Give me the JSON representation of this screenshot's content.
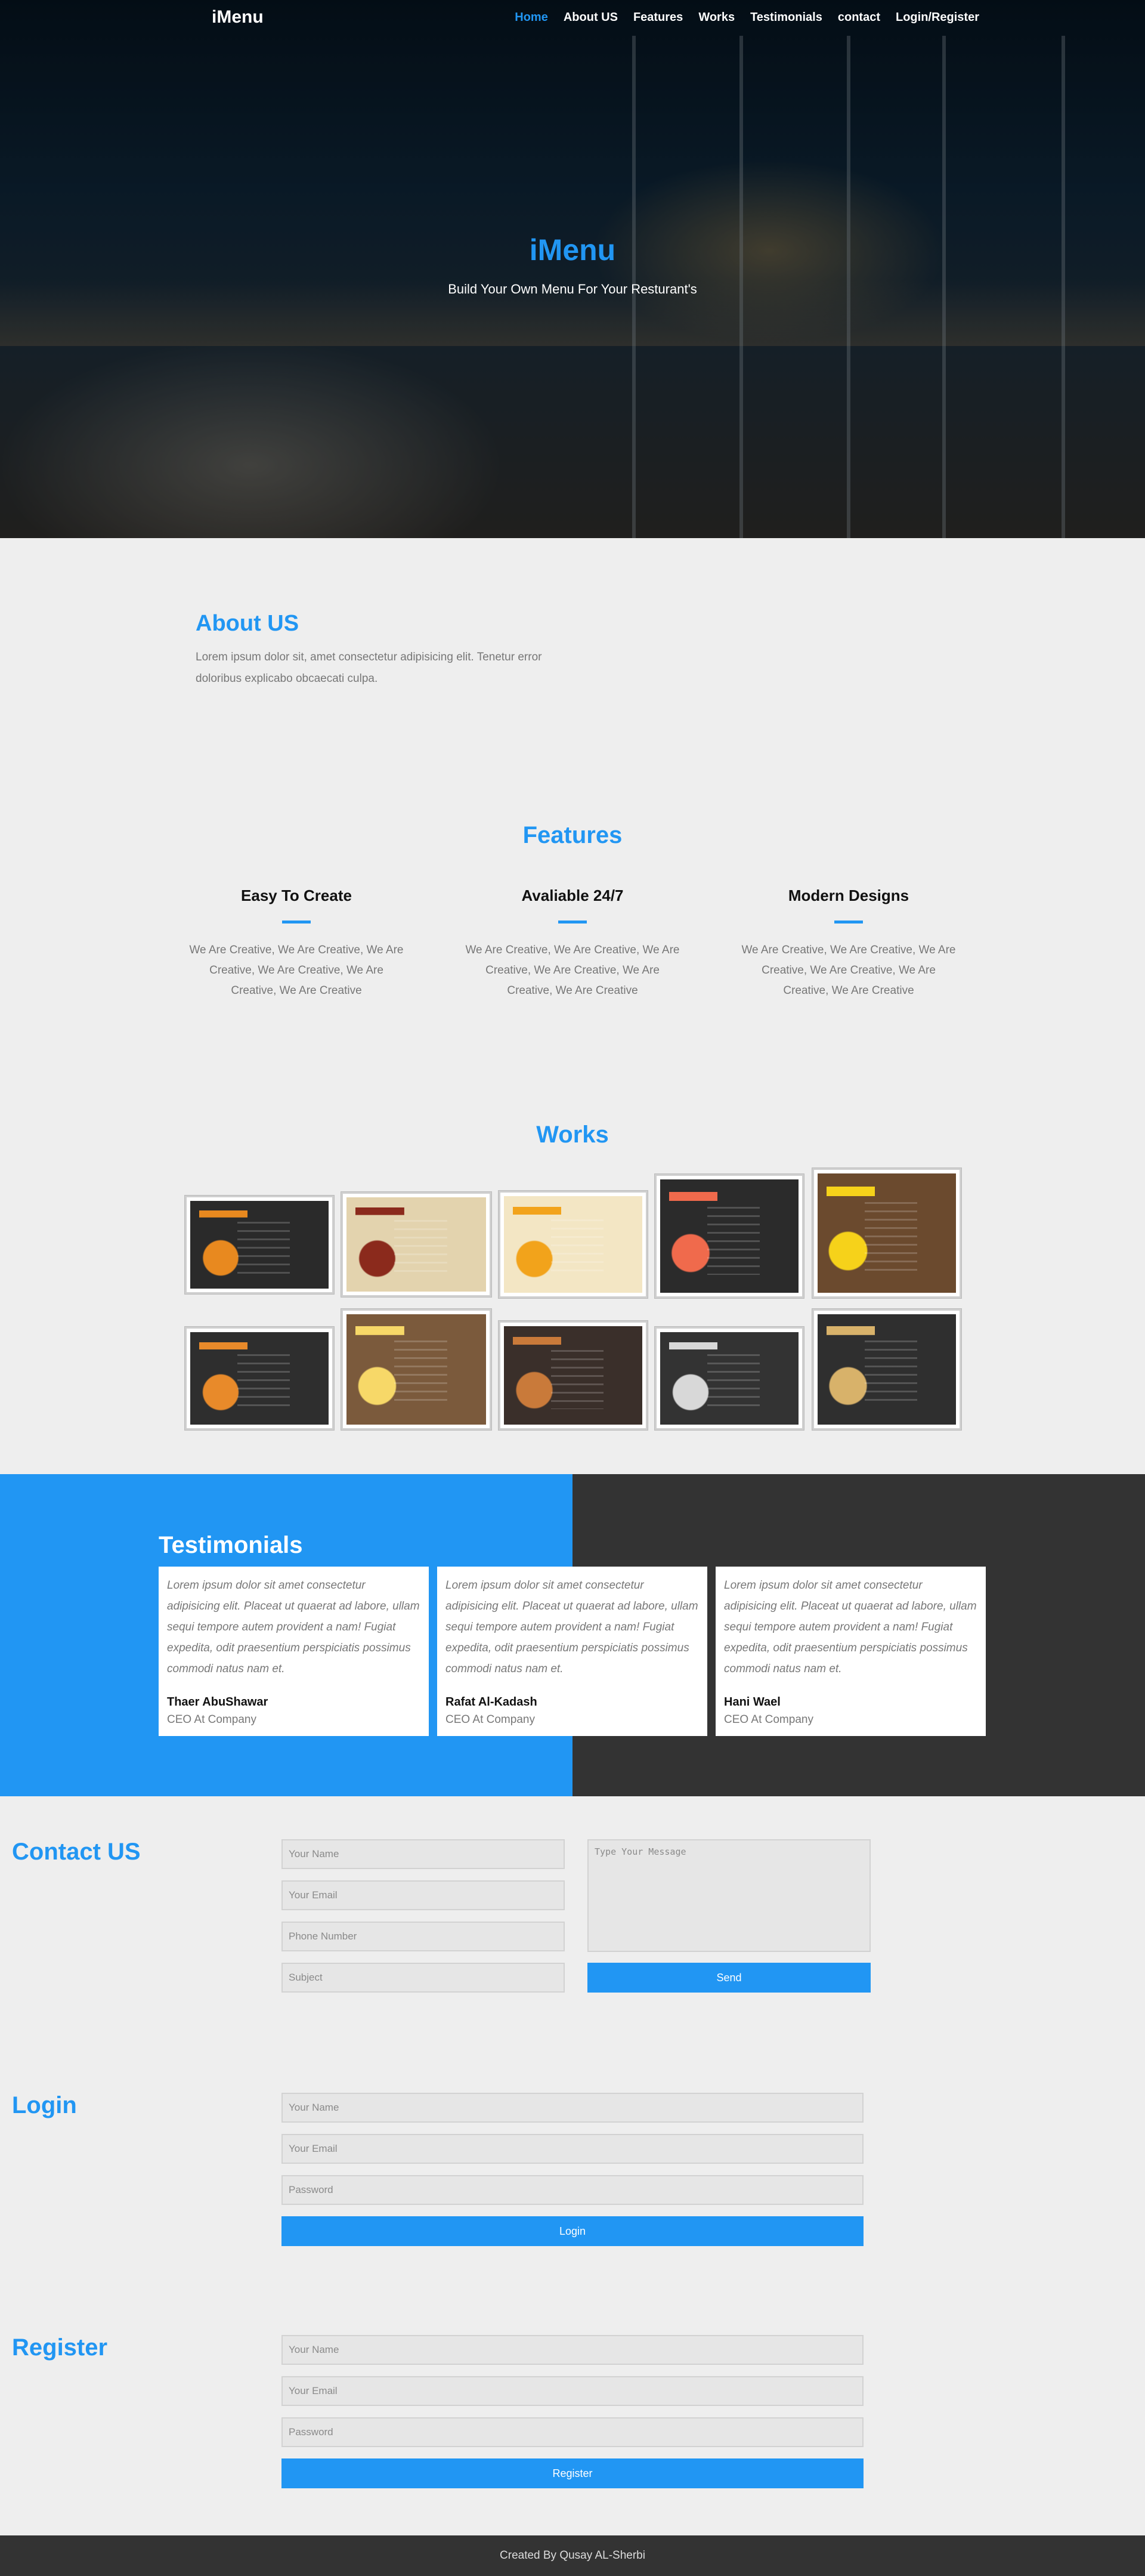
{
  "brand": "iMenu",
  "nav": {
    "items": [
      "Home",
      "About US",
      "Features",
      "Works",
      "Testimonials",
      "contact",
      "Login/Register"
    ],
    "active": "Home"
  },
  "hero": {
    "title": "iMenu",
    "subtitle": "Build Your Own Menu For Your Resturant's"
  },
  "about": {
    "title": "About US",
    "text": "Lorem ipsum dolor sit, amet consectetur adipisicing elit. Tenetur error doloribus explicabo obcaecati culpa."
  },
  "features": {
    "title": "Features",
    "items": [
      {
        "title": "Easy To Create",
        "text": "We Are Creative, We Are Creative, We Are Creative, We Are Creative, We Are Creative, We Are Creative"
      },
      {
        "title": "Avaliable 24/7",
        "text": "We Are Creative, We Are Creative, We Are Creative, We Are Creative, We Are Creative, We Are Creative"
      },
      {
        "title": "Modern Designs",
        "text": "We Are Creative, We Are Creative, We Are Creative, We Are Creative, We Are Creative, We Are Creative"
      }
    ]
  },
  "works": {
    "title": "Works",
    "items": [
      {
        "name": "menu-dark-burger",
        "bg": "#2a2a2a",
        "accent": "#e8891f"
      },
      {
        "name": "menu-vintage",
        "bg": "#e3d3ae",
        "accent": "#8b2a1c"
      },
      {
        "name": "menu-eat-drink-enjoy",
        "bg": "#f3e6c4",
        "accent": "#f2a31b"
      },
      {
        "name": "menu-breakfast",
        "bg": "#2b2b2b",
        "accent": "#f06a4c"
      },
      {
        "name": "menu-wood",
        "bg": "#6b4a2e",
        "accent": "#f6d21a"
      },
      {
        "name": "menu-restaurant-dark",
        "bg": "#2e2e2e",
        "accent": "#e88a2a"
      },
      {
        "name": "menu-yellow-board",
        "bg": "#7b5a3c",
        "accent": "#f7d868"
      },
      {
        "name": "menu-chalk-frame",
        "bg": "#3a2f2a",
        "accent": "#c97a3a"
      },
      {
        "name": "menu-chalkboard",
        "bg": "#333333",
        "accent": "#d8d8d8"
      },
      {
        "name": "menu-script-chalk",
        "bg": "#2f2f2f",
        "accent": "#d8b26a"
      }
    ]
  },
  "testimonials": {
    "title": "Testimonials",
    "items": [
      {
        "quote": "Lorem ipsum dolor sit amet consectetur adipisicing elit. Placeat ut quaerat ad labore, ullam sequi tempore autem provident a nam! Fugiat expedita, odit praesentium perspiciatis possimus commodi natus nam et.",
        "name": "Thaer AbuShawar",
        "role": "CEO At Company"
      },
      {
        "quote": "Lorem ipsum dolor sit amet consectetur adipisicing elit. Placeat ut quaerat ad labore, ullam sequi tempore autem provident a nam! Fugiat expedita, odit praesentium perspiciatis possimus commodi natus nam et.",
        "name": "Rafat Al-Kadash",
        "role": "CEO At Company"
      },
      {
        "quote": "Lorem ipsum dolor sit amet consectetur adipisicing elit. Placeat ut quaerat ad labore, ullam sequi tempore autem provident a nam! Fugiat expedita, odit praesentium perspiciatis possimus commodi natus nam et.",
        "name": "Hani Wael",
        "role": "CEO At Company"
      }
    ]
  },
  "contact": {
    "title": "Contact US",
    "name_placeholder": "Your Name",
    "email_placeholder": "Your Email",
    "phone_placeholder": "Phone Number",
    "subject_placeholder": "Subject",
    "message_placeholder": "Type Your Message",
    "send_label": "Send"
  },
  "login": {
    "title": "Login",
    "name_placeholder": "Your Name",
    "email_placeholder": "Your Email",
    "password_placeholder": "Password",
    "button_label": "Login"
  },
  "register": {
    "title": "Register",
    "name_placeholder": "Your Name",
    "email_placeholder": "Your Email",
    "password_placeholder": "Password",
    "button_label": "Register"
  },
  "footer": {
    "text": "Created By Qusay AL-Sherbi"
  },
  "colors": {
    "accent": "#2196f3",
    "dark": "#333333",
    "page_bg": "#eeeeee"
  }
}
